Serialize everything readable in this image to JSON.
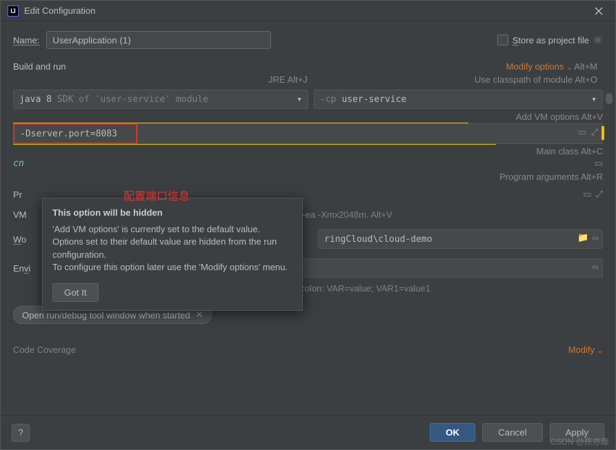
{
  "titlebar": {
    "title": "Edit Configuration"
  },
  "name": {
    "label": "Name:",
    "value": "UserApplication (1)"
  },
  "store": {
    "label": "Store as project file"
  },
  "build": {
    "section_title": "Build and run",
    "modify_label": "Modify options",
    "modify_shortcut": "Alt+M",
    "jre_hint": "JRE Alt+J",
    "classpath_hint": "Use classpath of module Alt+O",
    "jdk_prefix": "java 8",
    "jdk_suffix": " SDK of 'user-service' module",
    "cp_prefix": "-cp ",
    "cp_value": "user-service",
    "add_vm_hint": "Add VM options Alt+V",
    "vm_options_value": "-Dserver.port=8083",
    "main_class_hint": "Main class Alt+C",
    "program_args_hint": "Program arguments Alt+R"
  },
  "annotation": "配置端口信息",
  "tooltip": {
    "title": "This option will be hidden",
    "body": "'Add VM options' is currently set to the default value. Options set to their default value are hidden from the run configuration.\nTo configure this option later use the 'Modify options' menu.",
    "button": "Got It"
  },
  "fields": {
    "cn_label": "cn",
    "pr_label": "Pr",
    "vm_label": "VM",
    "vm_hint": "le: -ea -Xmx2048m. Alt+V",
    "wo_label": "Wo",
    "wo_value": "ringCloud\\cloud-demo",
    "env_label": "Envi",
    "env_helper": "Separate variables with semicolon: VAR=value; VAR1=value1"
  },
  "tag": {
    "label": "Open run/debug tool window when started"
  },
  "coverage": {
    "label": "Code Coverage",
    "modify": "Modify"
  },
  "footer": {
    "ok": "OK",
    "cancel": "Cancel",
    "apply": "Apply",
    "help": "?"
  },
  "watermark": "CSDN @陈亦康"
}
